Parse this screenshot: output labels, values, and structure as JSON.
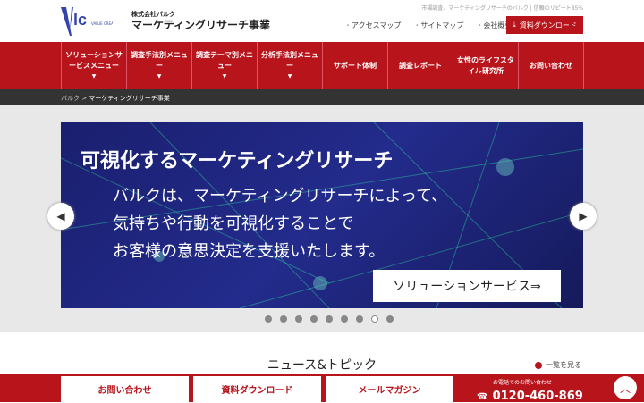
{
  "header": {
    "logo_text": "VLC",
    "logo_sub": "VALUE CREATE",
    "company": "株式会社バルク",
    "division": "マーケティングリサーチ事業",
    "tagline": "市場調査、マーケティングリサーチのバルク | 信頼のリピート85%",
    "links": [
      "アクセスマップ",
      "サイトマップ",
      "会社概要"
    ],
    "download": "資料ダウンロード"
  },
  "nav": [
    {
      "label": "ソリューションサービスメニュー",
      "dropdown": true
    },
    {
      "label": "調査手法別メニュー",
      "dropdown": true
    },
    {
      "label": "調査テーマ別メニュー",
      "dropdown": true
    },
    {
      "label": "分析手法別メニュー",
      "dropdown": true
    },
    {
      "label": "サポート体制"
    },
    {
      "label": "調査レポート"
    },
    {
      "label": "女性のライフスタイル研究所"
    },
    {
      "label": "お問い合わせ"
    }
  ],
  "breadcrumb": {
    "home": "バルク",
    "sep": ">",
    "current": "マーケティングリサーチ事業"
  },
  "banner": {
    "title": "可視化するマーケティングリサーチ",
    "lines": [
      "バルクは、マーケティングリサーチによって、",
      "気持ちや行動を可視化することで",
      "お客様の意思決定を支援いたします。"
    ],
    "button": "ソリューションサービス⇒",
    "slides": 9,
    "active_slide": 8
  },
  "news": {
    "title": "ニュース&トピック",
    "more": "一覧を見る"
  },
  "footer": {
    "contact": "お問い合わせ",
    "download": "資料ダウンロード",
    "mail": "メールマガジン",
    "tel_label": "お電話でのお問い合わせ",
    "tel": "0120-460-869"
  },
  "colors": {
    "brand": "#b8141b",
    "banner": "#1f2580"
  }
}
